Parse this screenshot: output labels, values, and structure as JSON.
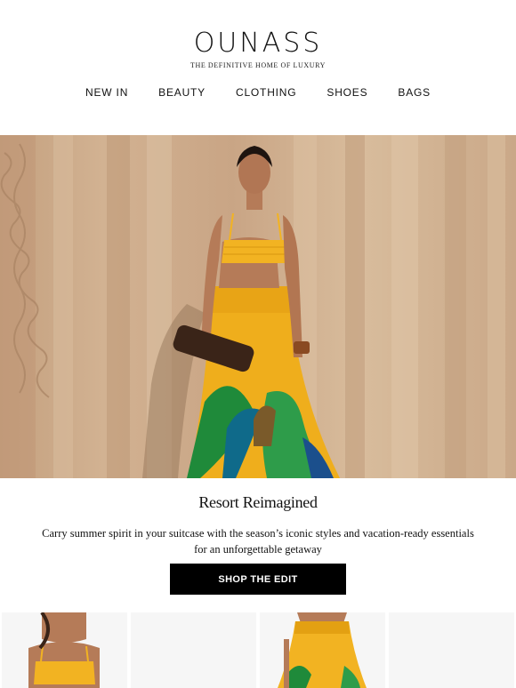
{
  "header": {
    "logo": "OUNASS",
    "tagline": "THE DEFINITIVE HOME OF LUXURY"
  },
  "nav": {
    "items": [
      "NEW IN",
      "BEAUTY",
      "CLOTHING",
      "SHOES",
      "BAGS"
    ]
  },
  "hero": {
    "image": "model-yellow-resort-outfit"
  },
  "campaign": {
    "title": "Resort Reimagined",
    "body": "Carry summer spirit in your suitcase with the season’s iconic styles and vacation-ready essentials for an unforgettable getaway",
    "cta_label": "SHOP THE EDIT"
  },
  "products": [
    {
      "image": "yellow-crop-top"
    },
    {
      "image": "blank-product"
    },
    {
      "image": "yellow-printed-skirt"
    },
    {
      "image": "blank-product"
    }
  ],
  "colors": {
    "accent": "#000000",
    "hero_yellow": "#f0b020",
    "background": "#ffffff"
  }
}
